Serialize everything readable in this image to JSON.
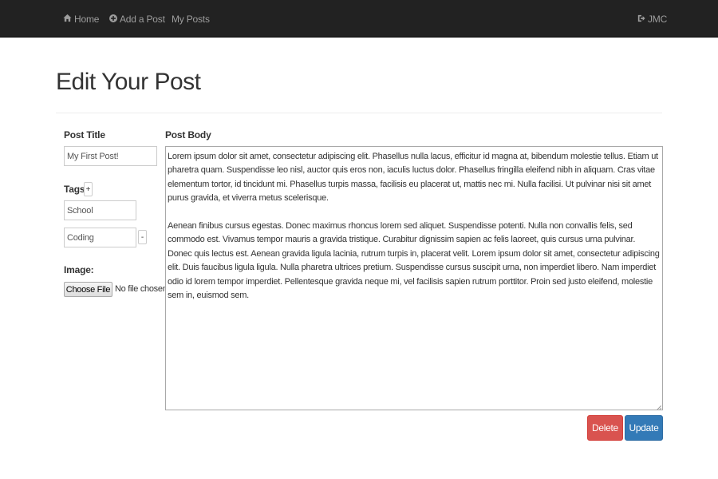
{
  "nav": {
    "home_label": "Home",
    "add_post_label": "Add a Post",
    "my_posts_label": "My Posts",
    "user_label": "JMC",
    "icons": [
      "home-icon",
      "plus-circle-icon",
      "logout-icon"
    ]
  },
  "page": {
    "title": "Edit Your Post"
  },
  "form": {
    "post_title_label": "Post Title",
    "post_title_value": "My First Post!",
    "tags_label": "Tags",
    "add_tag_label": "+",
    "remove_tag_label": "-",
    "tags": [
      "School",
      "Coding"
    ],
    "image_label": "Image:",
    "choose_file_label": "Choose File",
    "file_status": "No file chosen",
    "post_body_label": "Post Body",
    "post_body_paragraphs": [
      "Lorem ipsum dolor sit amet, consectetur adipiscing elit. Phasellus nulla lacus, efficitur id magna at, bibendum molestie tellus. Etiam ut pharetra quam. Suspendisse leo nisl, auctor quis eros non, iaculis luctus dolor. Phasellus fringilla eleifend nibh in aliquam. Cras vitae elementum tortor, id tincidunt mi. Phasellus turpis massa, facilisis eu placerat ut, mattis nec mi. Nulla facilisi. Ut pulvinar nisi sit amet purus gravida, et viverra metus scelerisque.",
      "Aenean finibus cursus egestas. Donec maximus rhoncus lorem sed aliquet. Suspendisse potenti. Nulla non convallis felis, sed commodo est. Vivamus tempor mauris a gravida tristique. Curabitur dignissim sapien ac felis laoreet, quis cursus urna pulvinar. Donec quis lectus est. Aenean gravida ligula lacinia, rutrum turpis in, placerat velit. Lorem ipsum dolor sit amet, consectetur adipiscing elit. Duis faucibus ligula ligula. Nulla pharetra ultrices pretium. Suspendisse cursus suscipit urna, non imperdiet libero. Nam imperdiet odio id lorem tempor imperdiet. Pellentesque gravida neque mi, vel facilisis sapien rutrum porttitor. Proin sed justo eleifend, molestie sem in, euismod sem."
    ],
    "delete_label": "Delete",
    "update_label": "Update"
  },
  "colors": {
    "navbar_bg": "#222222",
    "nav_text": "#9d9d9d",
    "delete_bg": "#d9534f",
    "update_bg": "#337ab7"
  }
}
